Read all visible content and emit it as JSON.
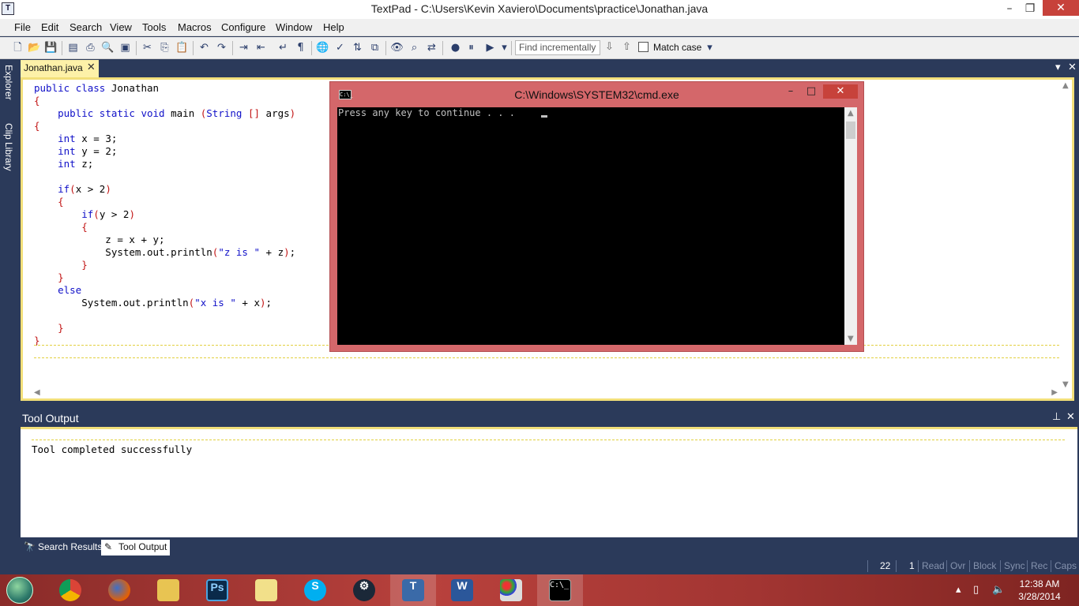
{
  "window": {
    "title": "TextPad - C:\\Users\\Kevin Xaviero\\Documents\\practice\\Jonathan.java",
    "minimize": "–",
    "maximize": "❐",
    "close": "✕"
  },
  "menu": [
    "File",
    "Edit",
    "Search",
    "View",
    "Tools",
    "Macros",
    "Configure",
    "Window",
    "Help"
  ],
  "toolbar": {
    "find_placeholder": "Find incrementally",
    "find_down": "⇩",
    "find_up": "⇧",
    "match_case_label": "Match case",
    "icons": [
      "new-file",
      "open",
      "save",
      "save-all",
      "print",
      "print-preview",
      "page-setup",
      "cut",
      "copy",
      "paste",
      "undo",
      "redo",
      "indent",
      "outdent",
      "word-wrap",
      "pilcrow",
      "web-browser",
      "spell-check",
      "sort",
      "compare",
      "find",
      "find-in-files",
      "replace",
      "macro-record",
      "macro-pause",
      "macro-play",
      "overflow"
    ]
  },
  "sidedock": {
    "explorer": "Explorer",
    "clip_library": "Clip Library"
  },
  "editor": {
    "tab_label": "Jonathan.java",
    "tab_close": "✕",
    "code_lines": [
      "public class Jonathan",
      "{",
      "    public static void main (String [] args)",
      "{",
      "    int x = 3;",
      "    int y = 2;",
      "    int z;",
      "",
      "    if(x > 2)",
      "    {",
      "        if(y > 2)",
      "        {",
      "            z = x + y;",
      "            System.out.println(\"z is \" + z);",
      "        }",
      "    }",
      "    else",
      "        System.out.println(\"x is \" + x);",
      "",
      "    }",
      "}"
    ]
  },
  "tool_output": {
    "title": "Tool Output",
    "text": "Tool completed successfully",
    "pin": "⊥",
    "close": "✕"
  },
  "bottom_tabs": [
    "Search Results",
    "Tool Output"
  ],
  "statusbar": {
    "line": "22",
    "column": "1",
    "flags": [
      "Read",
      "Ovr",
      "Block",
      "Sync",
      "Rec",
      "Caps"
    ]
  },
  "cmd": {
    "title": "C:\\Windows\\SYSTEM32\\cmd.exe",
    "output": "Press any key to continue . . . ",
    "icon_text": "C:\\_"
  },
  "taskbar": {
    "apps": [
      "windows-orb",
      "chrome",
      "firefox",
      "file-explorer",
      "photoshop",
      "folder",
      "skype",
      "steam",
      "textpad",
      "word",
      "paint",
      "command-prompt"
    ],
    "time": "12:38 AM",
    "date": "3/28/2014"
  }
}
